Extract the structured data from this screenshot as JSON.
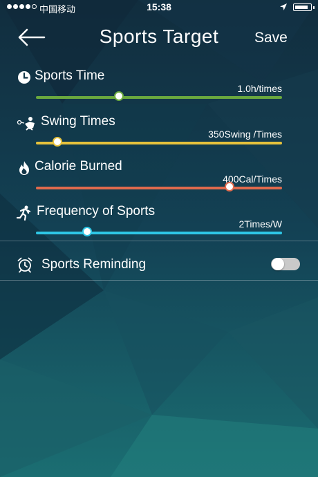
{
  "status_bar": {
    "carrier": "中国移动",
    "time": "15:38",
    "signal_bars_filled": 4,
    "signal_bars_total": 5,
    "battery_level": 0.9
  },
  "header": {
    "back_icon": "arrow-left-icon",
    "title": "Sports Target",
    "save_label": "Save"
  },
  "targets": [
    {
      "icon": "clock-icon",
      "label": "Sports Time",
      "value": "1.0h/times",
      "slider_fraction": 0.34,
      "color": "#6aa83e"
    },
    {
      "icon": "swing-icon",
      "label": "Swing Times",
      "value": "350Swing /Times",
      "slider_fraction": 0.09,
      "color": "#e6c23c"
    },
    {
      "icon": "flame-icon",
      "label": "Calorie Burned",
      "value": "400Cal/Times",
      "slider_fraction": 0.79,
      "color": "#e06a4d"
    },
    {
      "icon": "runner-icon",
      "label": "Frequency of Sports",
      "value": "2Times/W",
      "slider_fraction": 0.21,
      "color": "#2ec7e6"
    }
  ],
  "reminder": {
    "icon": "alarm-clock-icon",
    "label": "Sports Reminding",
    "enabled": false
  }
}
